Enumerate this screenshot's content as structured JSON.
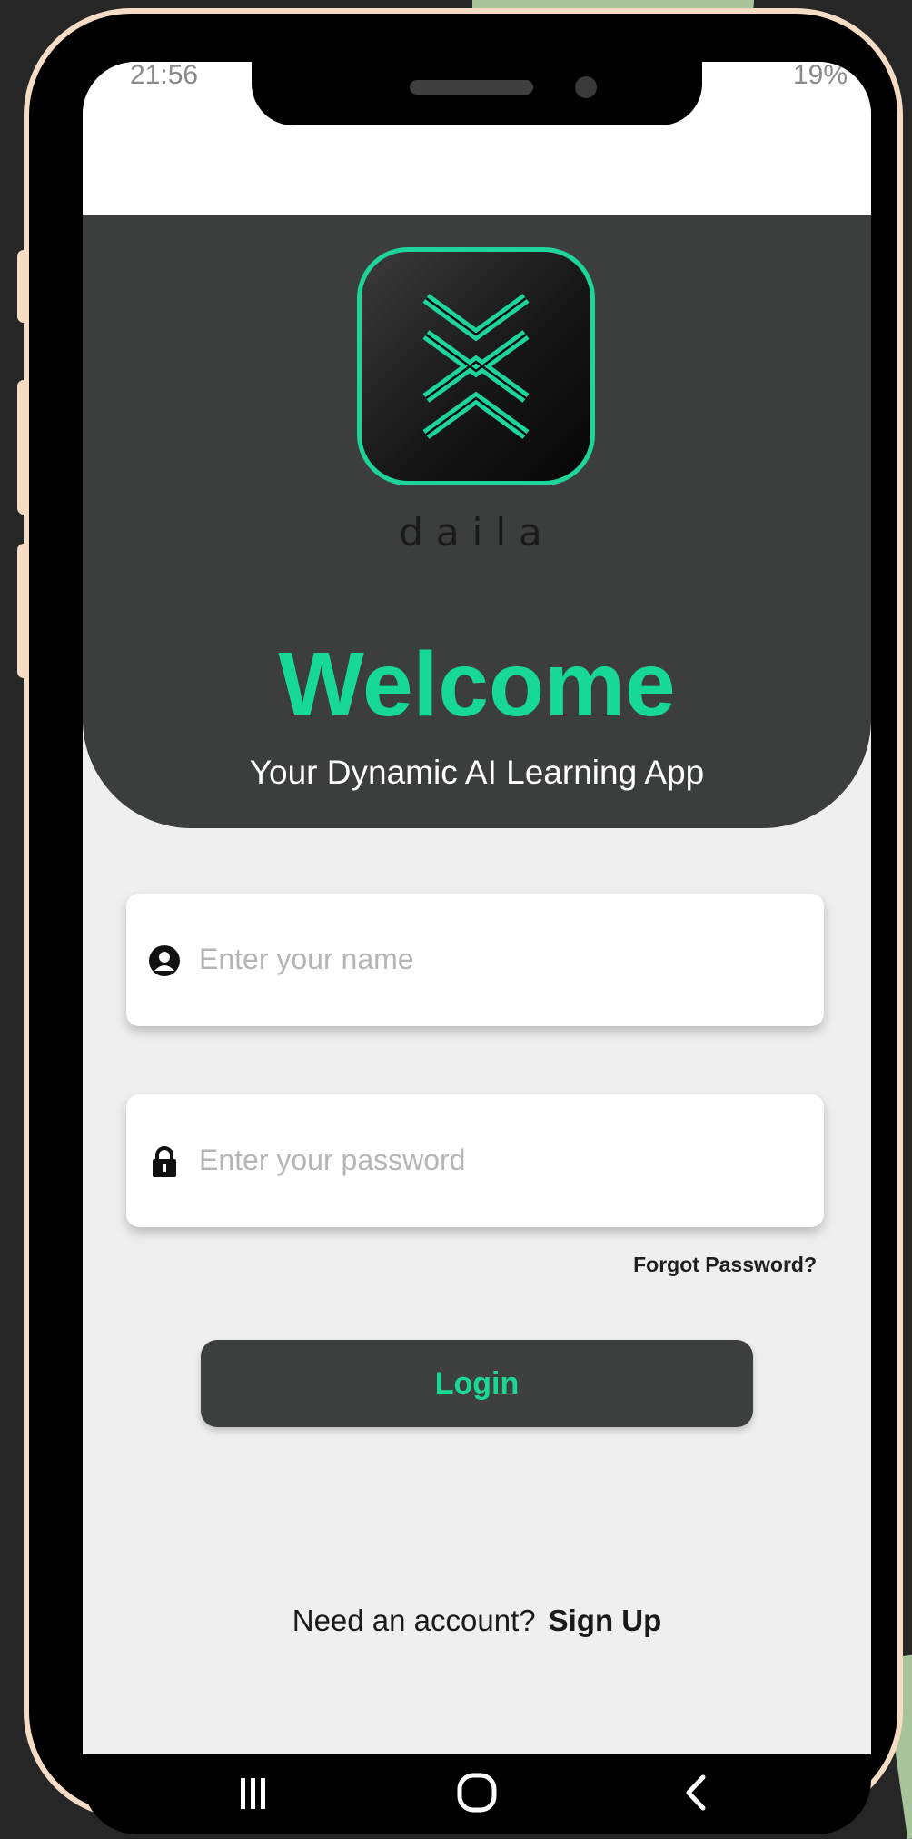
{
  "status_bar": {
    "time": "21:56",
    "right": "19%"
  },
  "logo": {
    "wordmark": "daila"
  },
  "header": {
    "title": "Welcome",
    "subtitle": "Your Dynamic AI Learning App"
  },
  "form": {
    "name_placeholder": "Enter your name",
    "password_placeholder": "Enter your password",
    "forgot_label": "Forgot Password?",
    "login_label": "Login"
  },
  "footer": {
    "prompt": "Need an account?",
    "signup_label": "Sign Up"
  },
  "icons": {
    "name_field": "user-circle-icon",
    "password_field": "lock-icon",
    "nav": [
      "recent-apps-icon",
      "home-icon",
      "back-icon"
    ]
  },
  "colors": {
    "accent": "#17d896",
    "panel": "#3c3e3d",
    "screen_bg": "#efefef",
    "frame": "#f6dcc4"
  }
}
